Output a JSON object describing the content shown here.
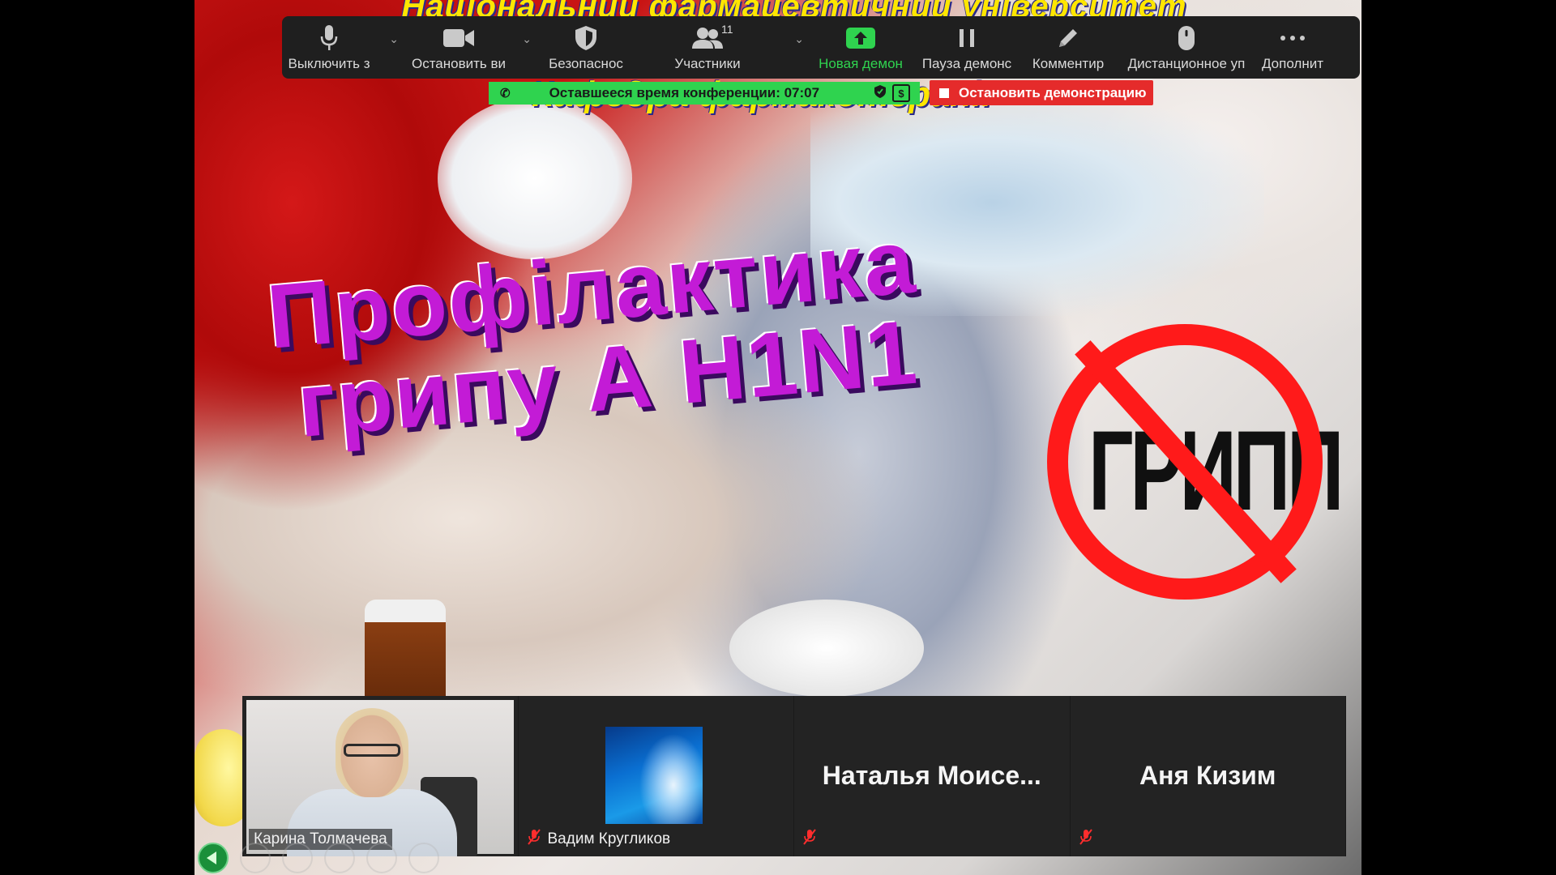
{
  "slide": {
    "header_line1": "Національний фармацевтичний університет",
    "header_line2": "Кафедра фармакотерапії",
    "title_line1": "Профілактика",
    "title_line2": "грипу А H1N1",
    "stamp_text": "ГРИПП"
  },
  "toolbar": {
    "items": [
      {
        "label": "Выключить з",
        "icon": "microphone-icon"
      },
      {
        "label": "Остановить ви",
        "icon": "video-camera-icon"
      },
      {
        "label": "Безопаснос",
        "icon": "shield-icon"
      },
      {
        "label": "Участники",
        "icon": "participants-icon",
        "badge": "11"
      },
      {
        "label": "Новая демон",
        "icon": "share-screen-icon"
      },
      {
        "label": "Пауза демонс",
        "icon": "pause-icon"
      },
      {
        "label": "Комментир",
        "icon": "pencil-icon"
      },
      {
        "label": "Дистанционное уп",
        "icon": "mouse-icon"
      },
      {
        "label": "Дополнит",
        "icon": "more-icon"
      }
    ],
    "accent_color": "#2fd34f"
  },
  "banner": {
    "timer_text": "Оставшееся время конференции: 07:07",
    "stop_share_label": "Остановить демонстрацию",
    "stop_color": "#e52b2b"
  },
  "participants": [
    {
      "name": "Карина Толмачева",
      "video": true
    },
    {
      "name": "Вадим Кругликов",
      "muted": true
    },
    {
      "display": "Наталья  Моисе...",
      "muted": true
    },
    {
      "display": "Аня Кизим",
      "muted": true
    }
  ]
}
